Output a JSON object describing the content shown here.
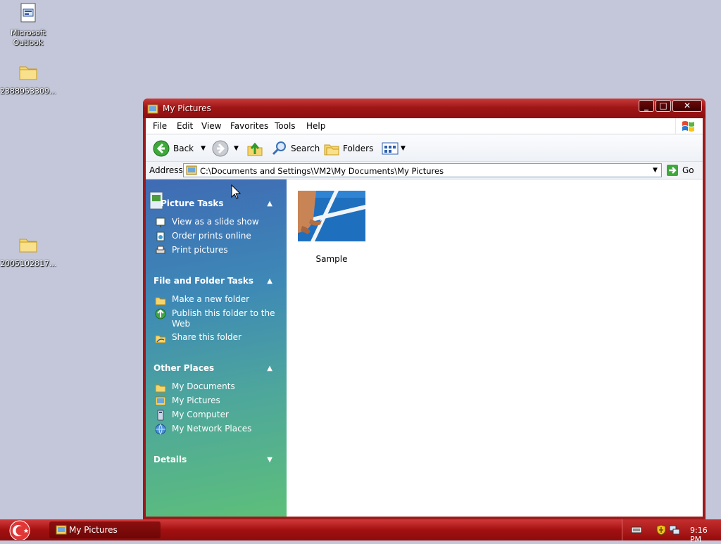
{
  "desktop": {
    "icons": [
      {
        "label": "Microsoft Outlook",
        "label_line1": "Microsoft",
        "label_line2": "Outlook"
      },
      {
        "label": "2388953309..."
      },
      {
        "label": "2005102817..."
      }
    ]
  },
  "window": {
    "title": "My Pictures",
    "menu": [
      "File",
      "Edit",
      "View",
      "Favorites",
      "Tools",
      "Help"
    ],
    "toolbar": {
      "back": "Back",
      "search": "Search",
      "folders": "Folders"
    },
    "address": {
      "label": "Address",
      "value": "C:\\Documents and Settings\\VM2\\My Documents\\My Pictures",
      "go": "Go"
    },
    "taskpane": {
      "picture_tasks": {
        "title": "Picture Tasks",
        "items": [
          "View as a slide show",
          "Order prints online",
          "Print pictures"
        ]
      },
      "file_folder_tasks": {
        "title": "File and Folder Tasks",
        "items": [
          "Make a new folder",
          "Publish this folder to the Web",
          "Share this folder"
        ]
      },
      "other_places": {
        "title": "Other Places",
        "items": [
          "My Documents",
          "My Pictures",
          "My Computer",
          "My Network Places"
        ]
      },
      "details": {
        "title": "Details"
      }
    },
    "files": [
      {
        "name": "Sample"
      }
    ]
  },
  "taskbar": {
    "task": "My Pictures",
    "clock": "9:16 PM"
  },
  "colors": {
    "titlebar": "#a01616",
    "taskbar": "#a31010",
    "desktop": "#c3c7d9"
  }
}
